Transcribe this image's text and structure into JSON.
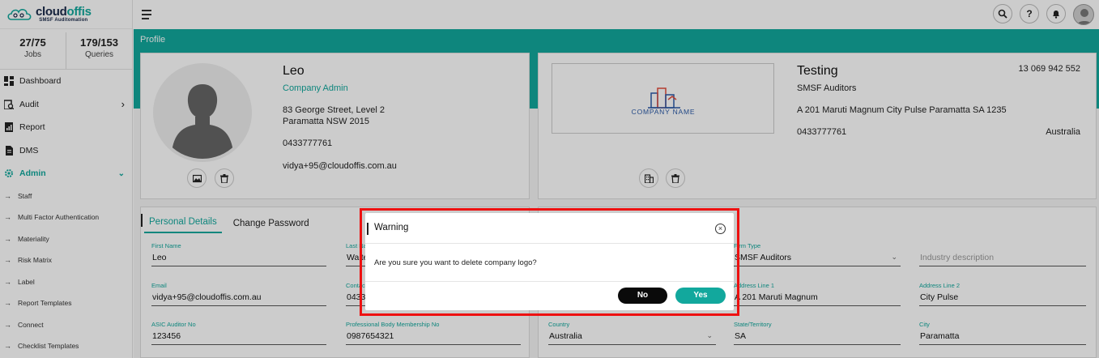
{
  "brand": {
    "name_part1": "cloud",
    "name_part2": "offis",
    "tagline": "SMSF Auditomation"
  },
  "stats": [
    {
      "value": "27/75",
      "label": "Jobs"
    },
    {
      "value": "179/153",
      "label": "Queries"
    }
  ],
  "nav": {
    "dashboard": "Dashboard",
    "audit": "Audit",
    "report": "Report",
    "dms": "DMS",
    "admin": "Admin"
  },
  "admin_items": [
    "Staff",
    "Multi Factor Authentication",
    "Materiality",
    "Risk Matrix",
    "Label",
    "Report Templates",
    "Connect",
    "Checklist Templates"
  ],
  "header": {
    "page_title": "Profile"
  },
  "profile": {
    "name": "Leo",
    "role": "Company Admin",
    "address_line1": "83 George Street, Level 2",
    "address_line2": "Paramatta NSW 2015",
    "phone": "0433777761",
    "email": "vidya+95@cloudoffis.com.au"
  },
  "company": {
    "name": "Testing",
    "abn": "13 069 942 552",
    "type": "SMSF Auditors",
    "address": "A 201 Maruti Magnum City Pulse Paramatta SA 1235",
    "phone": "0433777761",
    "country": "Australia",
    "logo_text": "COMPANY NAME"
  },
  "tabs": {
    "personal": "Personal Details",
    "password": "Change Password"
  },
  "personal_fields": {
    "first_name": {
      "label": "First Name",
      "value": "Leo"
    },
    "last_name": {
      "label": "Last Na",
      "value": "Walte"
    },
    "email": {
      "label": "Email",
      "value": "vidya+95@cloudoffis.com.au"
    },
    "contact": {
      "label": "Contac",
      "value": "0433"
    },
    "asic": {
      "label": "ASIC Auditor No",
      "value": "123456"
    },
    "body_membership": {
      "label": "Professional Body Membership No",
      "value": "0987654321"
    }
  },
  "company_fields": {
    "firm_type": {
      "label": "Firm Type",
      "value": "SMSF Auditors"
    },
    "industry": {
      "placeholder": "Industry description"
    },
    "address1": {
      "label": "Address Line 1",
      "value": "A 201 Maruti Magnum"
    },
    "address2": {
      "label": "Address Line 2",
      "value": "City Pulse"
    },
    "country": {
      "label": "Country",
      "value": "Australia"
    },
    "state": {
      "label": "State/Territory",
      "value": "SA"
    },
    "city": {
      "label": "City",
      "value": "Paramatta"
    }
  },
  "modal": {
    "title": "Warning",
    "message": "Are you sure you want to delete company logo?",
    "no_label": "No",
    "yes_label": "Yes",
    "close_glyph": "×"
  },
  "colors": {
    "accent": "#12a89d",
    "highlight_frame": "#e11111"
  }
}
